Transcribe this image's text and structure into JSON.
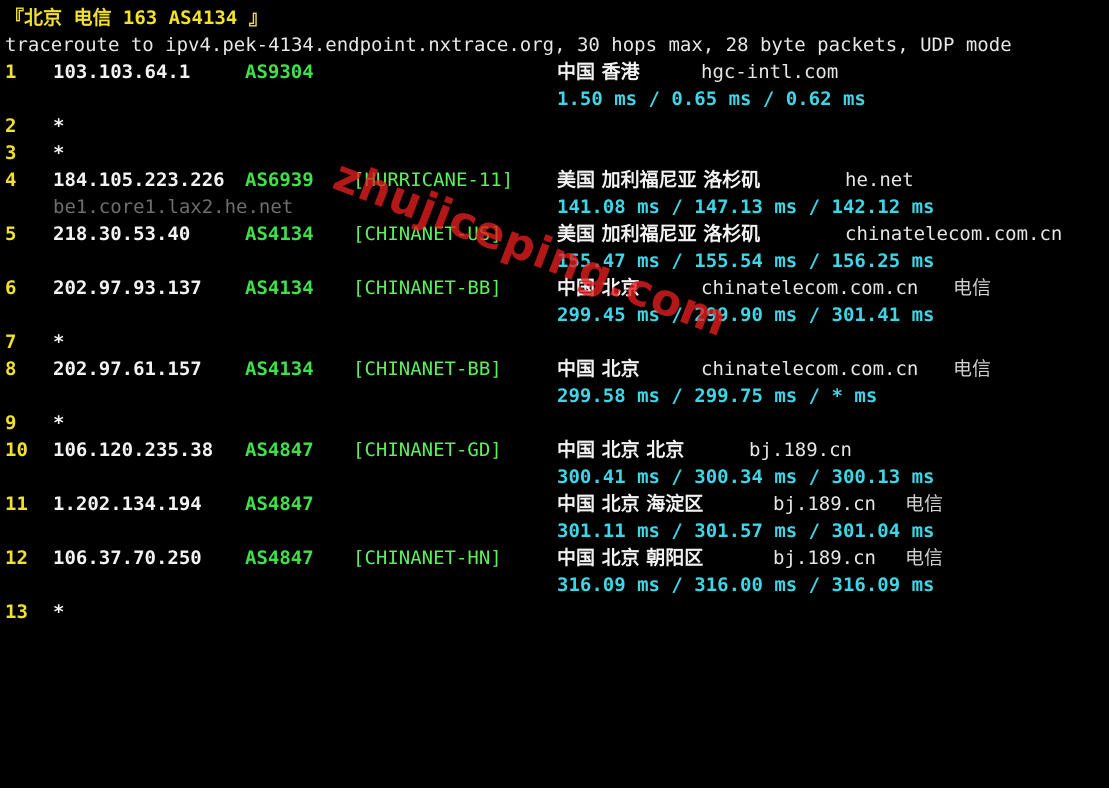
{
  "header": {
    "title": "『北京 电信 163 AS4134 』",
    "command": "traceroute to ipv4.pek-4134.endpoint.nxtrace.org, 30 hops max, 28 byte packets, UDP mode"
  },
  "hops": [
    {
      "n": "1",
      "ip": "103.103.64.1",
      "asn": "AS9304",
      "tag": "",
      "geo": "中国 香港",
      "host": "hgc-intl.com",
      "isp": "",
      "ptr": "",
      "rtt": "1.50 ms / 0.65 ms / 0.62 ms"
    },
    {
      "n": "2",
      "star": "*"
    },
    {
      "n": "3",
      "star": "*"
    },
    {
      "n": "4",
      "ip": "184.105.223.226",
      "asn": "AS6939",
      "tag": "[HURRICANE-11]",
      "geo": "美国 加利福尼亚 洛杉矶",
      "host": "he.net",
      "isp": "",
      "ptr": "be1.core1.lax2.he.net",
      "rtt": "141.08 ms / 147.13 ms / 142.12 ms"
    },
    {
      "n": "5",
      "ip": "218.30.53.40",
      "asn": "AS4134",
      "tag": "[CHINANET-US]",
      "geo": "美国 加利福尼亚 洛杉矶",
      "host": "chinatelecom.com.cn",
      "isp": "",
      "ptr": "",
      "rtt": "155.47 ms / 155.54 ms / 156.25 ms"
    },
    {
      "n": "6",
      "ip": "202.97.93.137",
      "asn": "AS4134",
      "tag": "[CHINANET-BB]",
      "geo": "中国 北京",
      "host": "chinatelecom.com.cn",
      "isp": "电信",
      "ptr": "",
      "rtt": "299.45 ms / 299.90 ms / 301.41 ms"
    },
    {
      "n": "7",
      "star": "*"
    },
    {
      "n": "8",
      "ip": "202.97.61.157",
      "asn": "AS4134",
      "tag": "[CHINANET-BB]",
      "geo": "中国 北京",
      "host": "chinatelecom.com.cn",
      "isp": "电信",
      "ptr": "",
      "rtt": "299.58 ms / 299.75 ms / * ms"
    },
    {
      "n": "9",
      "star": "*"
    },
    {
      "n": "10",
      "ip": "106.120.235.38",
      "asn": "AS4847",
      "tag": "[CHINANET-GD]",
      "geo": "中国 北京 北京",
      "host": "bj.189.cn",
      "isp": "",
      "ptr": "",
      "rtt": "300.41 ms / 300.34 ms / 300.13 ms"
    },
    {
      "n": "11",
      "ip": "1.202.134.194",
      "asn": "AS4847",
      "tag": "",
      "geo": "中国 北京 海淀区",
      "host": "bj.189.cn",
      "isp": "电信",
      "ptr": "",
      "rtt": "301.11 ms / 301.57 ms / 301.04 ms"
    },
    {
      "n": "12",
      "ip": "106.37.70.250",
      "asn": "AS4847",
      "tag": "[CHINANET-HN]",
      "geo": "中国 北京 朝阳区",
      "host": "bj.189.cn",
      "isp": "电信",
      "ptr": "",
      "rtt": "316.09 ms / 316.00 ms / 316.09 ms"
    },
    {
      "n": "13",
      "star": "*"
    }
  ],
  "watermark": "zhujiceping.com"
}
